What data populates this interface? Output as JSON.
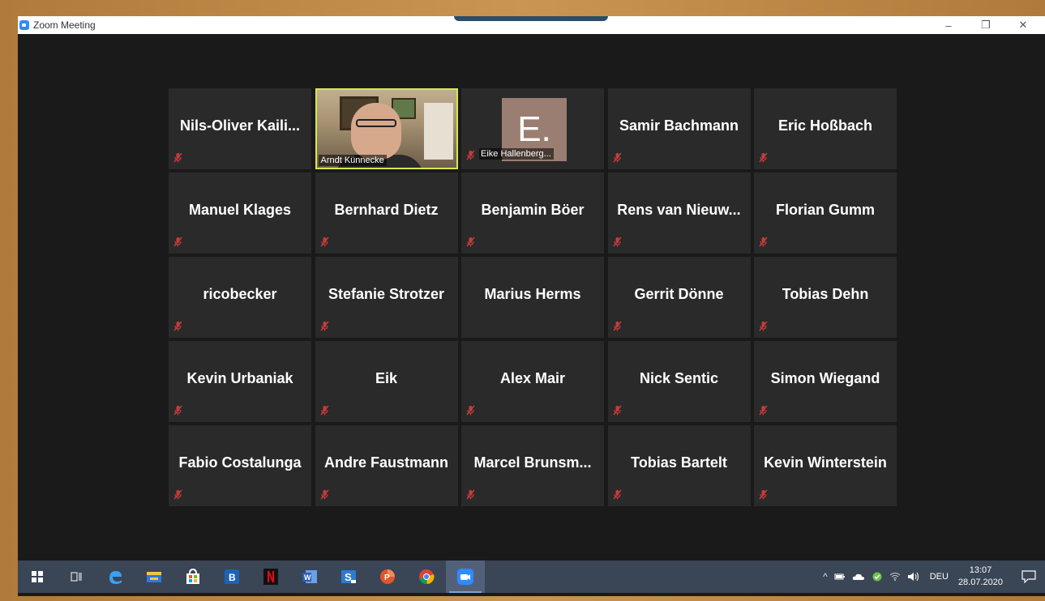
{
  "window": {
    "title": "Zoom Meeting",
    "minimize_glyph": "–",
    "maximize_glyph": "❐",
    "close_glyph": "✕"
  },
  "gallery": {
    "participants": [
      {
        "name": "Nils-Oliver  Kaili...",
        "muted": true
      },
      {
        "name": "Arndt Künnecke",
        "muted": false,
        "video": true,
        "active_speaker": true
      },
      {
        "name": "Eike Hallenberg...",
        "muted": true,
        "avatar_letter": "E."
      },
      {
        "name": "Samir Bachmann",
        "muted": true
      },
      {
        "name": "Eric Hoßbach",
        "muted": true
      },
      {
        "name": "Manuel Klages",
        "muted": true
      },
      {
        "name": "Bernhard Dietz",
        "muted": true
      },
      {
        "name": "Benjamin Böer",
        "muted": true
      },
      {
        "name": "Rens  van  Nieuw...",
        "muted": true
      },
      {
        "name": "Florian Gumm",
        "muted": true
      },
      {
        "name": "ricobecker",
        "muted": true
      },
      {
        "name": "Stefanie Strotzer",
        "muted": true
      },
      {
        "name": "Marius Herms",
        "muted": true
      },
      {
        "name": "Gerrit Dönne",
        "muted": true
      },
      {
        "name": "Tobias Dehn",
        "muted": true
      },
      {
        "name": "Kevin Urbaniak",
        "muted": true
      },
      {
        "name": "Eik",
        "muted": true
      },
      {
        "name": "Alex Mair",
        "muted": true
      },
      {
        "name": "Nick Sentic",
        "muted": true
      },
      {
        "name": "Simon Wiegand",
        "muted": true
      },
      {
        "name": "Fabio Costalunga",
        "muted": true
      },
      {
        "name": "Andre Faustmann",
        "muted": true
      },
      {
        "name": "Marcel  Brunsm...",
        "muted": true
      },
      {
        "name": "Tobias Bartelt",
        "muted": true
      },
      {
        "name": "Kevin Winterstein",
        "muted": true
      }
    ]
  },
  "taskbar": {
    "apps": [
      "start-icon",
      "task-view-icon",
      "edge-icon",
      "file-explorer-icon",
      "store-icon",
      "b-app-icon",
      "netflix-icon",
      "word-icon",
      "s-app-icon",
      "powerpoint-icon",
      "chrome-icon",
      "zoom-icon"
    ],
    "tray": {
      "chevron": "^",
      "language": "DEU",
      "time": "13:07",
      "date": "28.07.2020"
    }
  },
  "colors": {
    "speaker_border": "#d4e84a",
    "mute_red": "#c93b3b",
    "zoom_blue": "#2d8cff"
  }
}
